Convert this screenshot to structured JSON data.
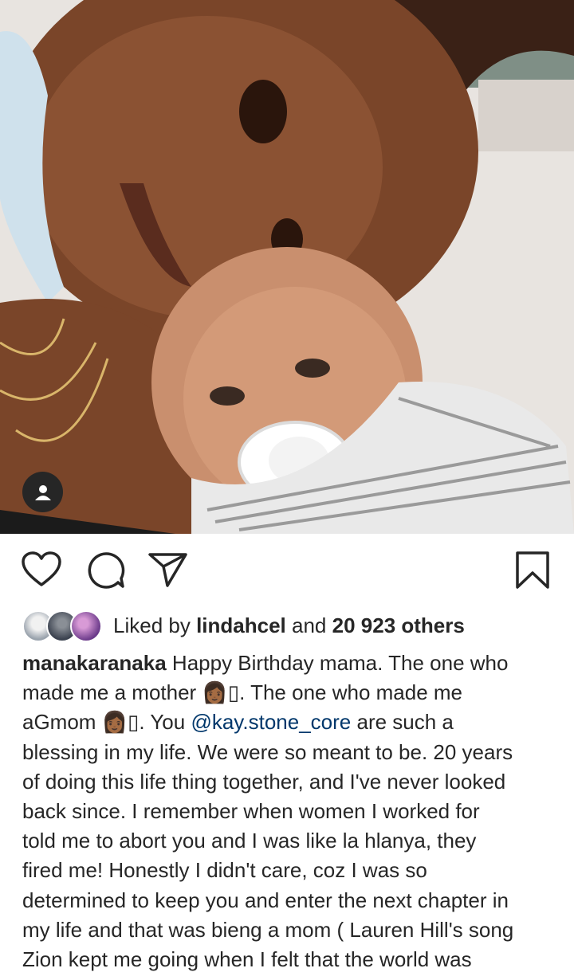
{
  "photo": {
    "description_icon": "person-icon"
  },
  "actions": {
    "like_icon": "heart-icon",
    "comment_icon": "comment-icon",
    "share_icon": "share-icon",
    "save_icon": "bookmark-icon"
  },
  "likes": {
    "prefix": "Liked by",
    "user": "lindahcel",
    "middle": "and",
    "count": "20 923 others"
  },
  "caption": {
    "username": "manakaranaka",
    "lines": [
      "Happy Birthday mama. The one who",
      "made me a mother 👩🏾▯. The one who made me",
      "aGmom 👩🏾▯. You",
      "blessing in my life. We were so meant to be. 20 years",
      "of doing this life thing together, and I've never looked",
      "back since. I remember when women I worked for",
      "told me to abort you and I was like la hlanya, they",
      "fired me! Honestly I didn't care, coz I was so",
      "determined to keep you and enter the next chapter in",
      "my life and that was bieng a mom ( Lauren Hill's song",
      "Zion kept me going when I felt that the world was"
    ],
    "mention": "@kay.stone_core",
    "after_mention": "are such a"
  }
}
